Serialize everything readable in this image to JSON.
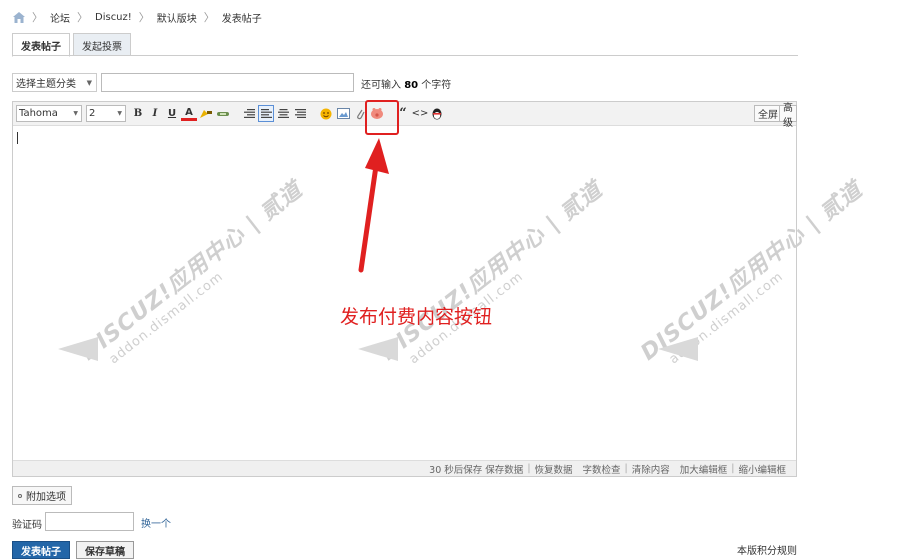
{
  "breadcrumb": [
    "论坛",
    "Discuz!",
    "默认版块",
    "发表帖子"
  ],
  "tabs": [
    {
      "label": "发表帖子",
      "active": true
    },
    {
      "label": "发起投票",
      "active": false
    }
  ],
  "subject": {
    "type_select": "选择主题分类",
    "placeholder": "",
    "limit_prefix": "还可输入",
    "limit_value": "80",
    "limit_suffix": "个字符"
  },
  "toolbar": {
    "font_family": "Tahoma",
    "font_size": "2",
    "bold": "B",
    "italic": "I",
    "underline": "U",
    "color": "A",
    "quote": "“",
    "code": "<>",
    "fullscreen": "全屏",
    "advanced": "高级"
  },
  "statusbar": {
    "autosave": "30 秒后保存",
    "save_data": "保存数据",
    "restore_data": "恢复数据",
    "word_check": "字数检查",
    "clear_content": "清除内容",
    "enlarge": "加大编辑框",
    "shrink": "缩小编辑框"
  },
  "watermark": {
    "brand": "DISCUZ!应用中心",
    "brand_cn": "贰道",
    "url": "addon.dismall.com"
  },
  "annotation": "发布付费内容按钮",
  "footer": {
    "extra_options": "附加选项",
    "captcha_label": "验证码",
    "captcha_change": "换一个",
    "submit": "发表帖子",
    "save_draft": "保存草稿",
    "rules": "本版积分规则"
  },
  "colors": {
    "accent_red": "#e02020",
    "primary_button": "#2366a8",
    "link": "#336699"
  }
}
